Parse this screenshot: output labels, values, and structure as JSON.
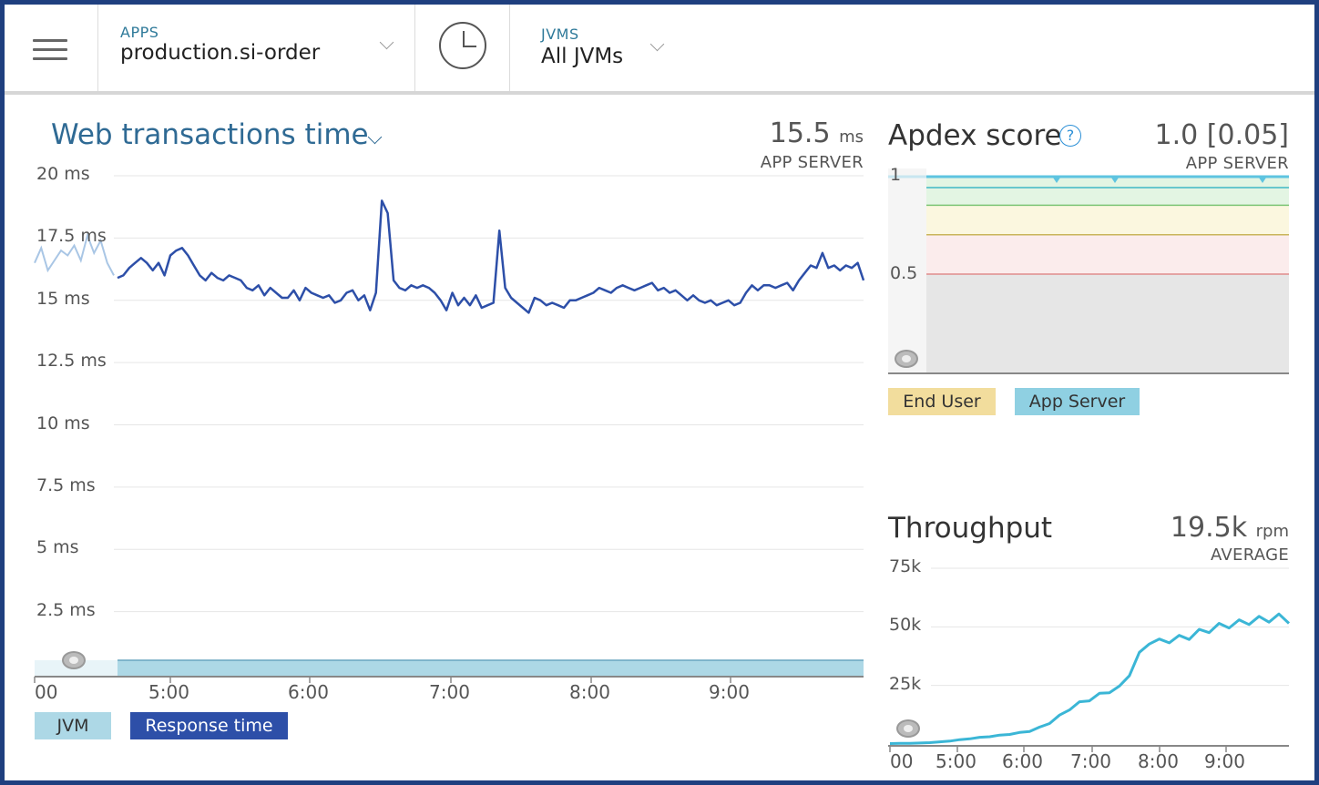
{
  "topbar": {
    "apps_label": "APPS",
    "apps_value": "production.si-order",
    "time_icon": "clock-icon",
    "jvms_label": "JVMS",
    "jvms_value": "All JVMs",
    "accent_color": "#9ac17a"
  },
  "web_transactions": {
    "title": "Web transactions time",
    "value": "15.5",
    "unit": "ms",
    "sub": "APP SERVER",
    "legend": [
      {
        "label": "JVM",
        "color": "#add8e6"
      },
      {
        "label": "Response time",
        "color": "#2d4fa8"
      }
    ]
  },
  "apdex": {
    "title": "Apdex score",
    "value": "1.0 [0.05]",
    "sub": "APP SERVER",
    "legend": [
      {
        "label": "End User",
        "color": "#f2dd9d"
      },
      {
        "label": "App Server",
        "color": "#8fd0e2"
      }
    ]
  },
  "throughput": {
    "title": "Throughput",
    "value": "19.5k",
    "unit": "rpm",
    "sub": "AVERAGE"
  },
  "chart_data": [
    {
      "type": "line",
      "title": "Web transactions time",
      "ylim": [
        0,
        20
      ],
      "y_ticks": [
        "20 ms",
        "17.5 ms",
        "15 ms",
        "12.5 ms",
        "10 ms",
        "7.5 ms",
        "5 ms",
        "2.5 ms"
      ],
      "x_ticks": [
        "00",
        "5:00",
        "6:00",
        "7:00",
        "8:00",
        "9:00"
      ],
      "series": [
        {
          "name": "Response time",
          "color": "#2d4fa8",
          "values": [
            15.9,
            16.0,
            16.3,
            16.5,
            16.7,
            16.5,
            16.2,
            16.5,
            16.0,
            16.8,
            17.0,
            17.1,
            16.8,
            16.4,
            16.0,
            15.8,
            16.1,
            15.9,
            15.8,
            16.0,
            15.9,
            15.8,
            15.5,
            15.4,
            15.6,
            15.2,
            15.5,
            15.3,
            15.1,
            15.1,
            15.4,
            15.0,
            15.5,
            15.3,
            15.2,
            15.1,
            15.2,
            14.9,
            15.0,
            15.3,
            15.4,
            15.0,
            15.2,
            14.6,
            15.3,
            19.0,
            18.5,
            15.8,
            15.5,
            15.4,
            15.6,
            15.5,
            15.6,
            15.5,
            15.3,
            15.0,
            14.6,
            15.3,
            14.8,
            15.1,
            14.8,
            15.2,
            14.7,
            14.8,
            14.9,
            17.8,
            15.5,
            15.1,
            14.9,
            14.7,
            14.5,
            15.1,
            15.0,
            14.8,
            14.9,
            14.8,
            14.7,
            15.0,
            15.0,
            15.1,
            15.2,
            15.3,
            15.5,
            15.4,
            15.3,
            15.5,
            15.6,
            15.5,
            15.4,
            15.5,
            15.6,
            15.7,
            15.4,
            15.5,
            15.3,
            15.4,
            15.2,
            15.0,
            15.2,
            15.0,
            14.9,
            15.0,
            14.8,
            14.9,
            15.0,
            14.8,
            14.9,
            15.3,
            15.6,
            15.4,
            15.6,
            15.6,
            15.5,
            15.6,
            15.7,
            15.4,
            15.8,
            16.1,
            16.4,
            16.3,
            16.9,
            16.3,
            16.4,
            16.2,
            16.4,
            16.3,
            16.5,
            15.8
          ]
        },
        {
          "name": "JVM",
          "color": "#a9c6e5",
          "values": [
            16.5,
            17.1,
            16.2,
            16.6,
            17.0,
            16.8,
            17.2,
            16.6,
            17.6,
            16.9,
            17.4,
            16.5,
            16.0
          ]
        }
      ]
    },
    {
      "type": "line",
      "title": "Apdex score",
      "ylim": [
        0,
        1
      ],
      "y_ticks": [
        "1",
        "0.5"
      ],
      "thresholds": [
        {
          "value": 0.94,
          "color": "#3fb8c6"
        },
        {
          "value": 0.85,
          "color": "#7cc576"
        },
        {
          "value": 0.7,
          "color": "#c9b55a"
        },
        {
          "value": 0.5,
          "color": "#e08c8c"
        }
      ],
      "series": [
        {
          "name": "App Server",
          "color": "#5ec4e0",
          "values": [
            1.0,
            1.0,
            1.0,
            1.0,
            1.0,
            1.0,
            1.0,
            1.0
          ]
        },
        {
          "name": "End User",
          "color": "#f2dd9d",
          "values": []
        }
      ]
    },
    {
      "type": "line",
      "title": "Throughput",
      "ylim": [
        0,
        75000
      ],
      "y_ticks": [
        "75k",
        "50k",
        "25k"
      ],
      "x_ticks": [
        "00",
        "5:00",
        "6:00",
        "7:00",
        "8:00",
        "9:00"
      ],
      "series": [
        {
          "name": "Throughput",
          "color": "#3bb6d6",
          "values": [
            200,
            250,
            300,
            400,
            600,
            900,
            1300,
            1800,
            2300,
            2800,
            3200,
            3700,
            4200,
            4800,
            5500,
            7000,
            9000,
            12000,
            15000,
            17500,
            19000,
            21000,
            22500,
            24000,
            30000,
            38000,
            44000,
            43500,
            44500,
            45000,
            46000,
            47500,
            49000,
            50000,
            51000,
            51500,
            52500,
            53000,
            53500,
            54000,
            53000
          ]
        }
      ]
    }
  ]
}
